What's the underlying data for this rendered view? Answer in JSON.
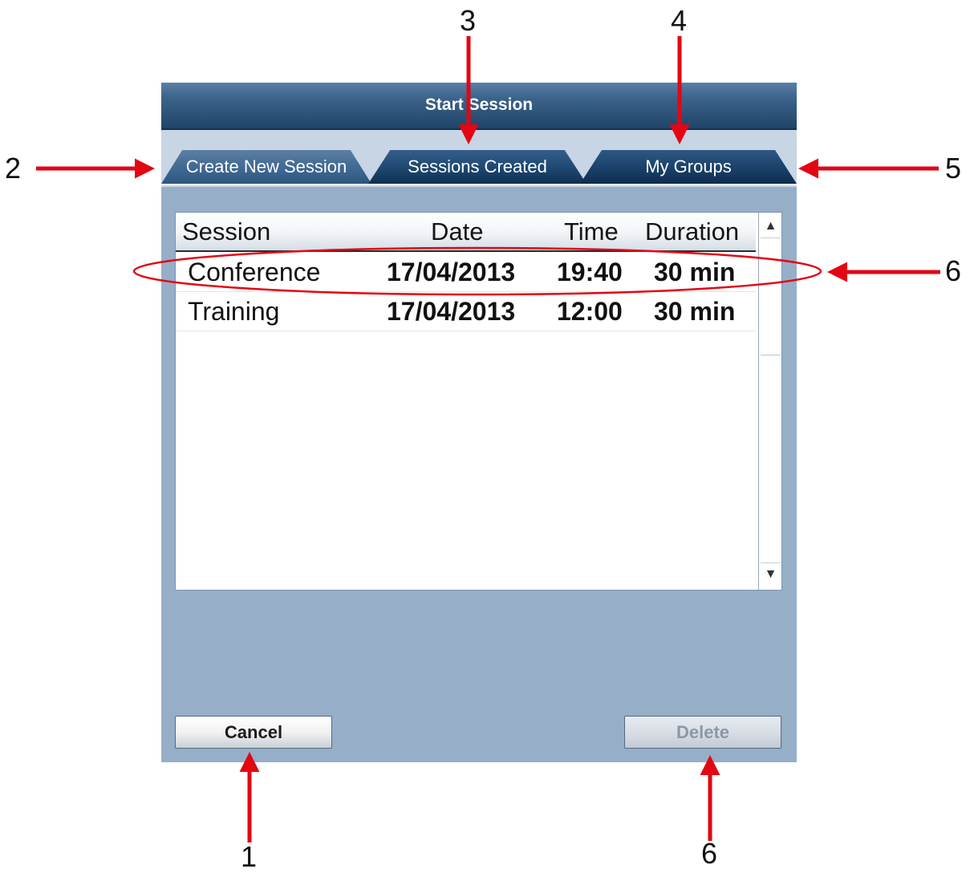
{
  "dialog": {
    "title": "Start Session",
    "tabs": [
      {
        "label": "Create New Session"
      },
      {
        "label": "Sessions Created"
      },
      {
        "label": "My Groups"
      }
    ],
    "table": {
      "columns": [
        "Session",
        "Date",
        "Time",
        "Duration"
      ],
      "rows": [
        {
          "session": "Conference",
          "date": "17/04/2013",
          "time": "19:40",
          "duration": "30 min"
        },
        {
          "session": "Training",
          "date": "17/04/2013",
          "time": "12:00",
          "duration": "30 min"
        }
      ],
      "scroll_up_icon": "▲",
      "scroll_down_icon": "▼"
    },
    "buttons": {
      "cancel": "Cancel",
      "delete": "Delete"
    }
  },
  "annotations": {
    "callouts": [
      "1",
      "2",
      "3",
      "4",
      "5",
      "6",
      "6"
    ],
    "accent_color": "#e30613"
  }
}
